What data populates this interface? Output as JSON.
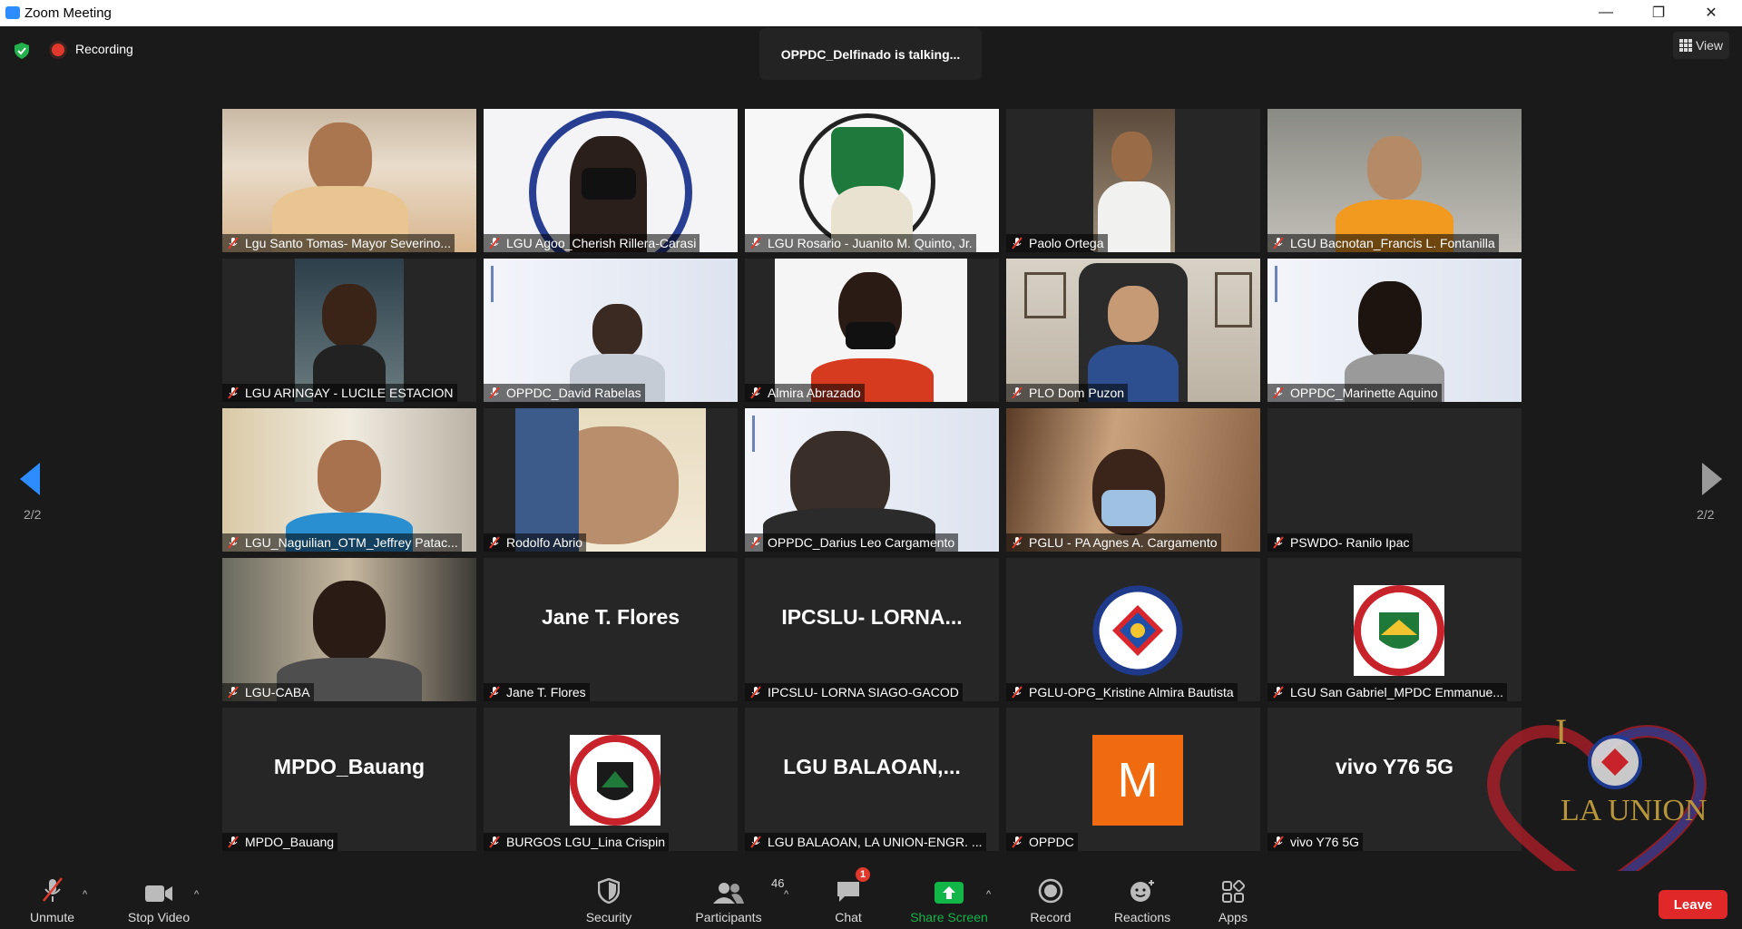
{
  "window": {
    "title": "Zoom Meeting"
  },
  "topbar": {
    "recording_label": "Recording",
    "talking": "OPPDC_Delfinado is talking...",
    "view_label": "View"
  },
  "pagination": {
    "left_page": "2/2",
    "right_page": "2/2"
  },
  "participants": [
    {
      "name": "Lgu Santo Tomas- Mayor Severino..."
    },
    {
      "name": "LGU Agoo_Cherish Rillera-Carasi"
    },
    {
      "name": "LGU Rosario - Juanito M. Quinto, Jr."
    },
    {
      "name": "Paolo Ortega"
    },
    {
      "name": "LGU Bacnotan_Francis L. Fontanilla"
    },
    {
      "name": "LGU ARINGAY - LUCILE ESTACION"
    },
    {
      "name": "OPPDC_David Rabelas"
    },
    {
      "name": "Almira Abrazado"
    },
    {
      "name": "PLO Dom Puzon"
    },
    {
      "name": "OPPDC_Marinette Aquino"
    },
    {
      "name": "LGU_Naguilian_OTM_Jeffrey Patac..."
    },
    {
      "name": "Rodolfo Abrio"
    },
    {
      "name": "OPPDC_Darius Leo Cargamento"
    },
    {
      "name": "PGLU - PA Agnes A. Cargamento"
    },
    {
      "name": "PSWDO- Ranilo Ipac"
    },
    {
      "name": "LGU-CABA"
    },
    {
      "name": "Jane T. Flores",
      "display": "Jane T. Flores"
    },
    {
      "name": "IPCSLU- LORNA SIAGO-GACOD",
      "display": "IPCSLU-  LORNA..."
    },
    {
      "name": "PGLU-OPG_Kristine Almira Bautista"
    },
    {
      "name": "LGU San Gabriel_MPDC Emmanue..."
    },
    {
      "name": "MPDO_Bauang",
      "display": "MPDO_Bauang"
    },
    {
      "name": "BURGOS LGU_Lina Crispin"
    },
    {
      "name": "LGU BALAOAN, LA UNION-ENGR. ...",
      "display": "LGU  BALAOAN,..."
    },
    {
      "name": "OPPDC",
      "avatar_letter": "M"
    },
    {
      "name": "vivo Y76 5G",
      "display": "vivo Y76 5G"
    }
  ],
  "toolbar": {
    "unmute": "Unmute",
    "stop_video": "Stop Video",
    "security": "Security",
    "participants": "Participants",
    "participants_count": "46",
    "chat": "Chat",
    "chat_badge": "1",
    "share_screen": "Share Screen",
    "record": "Record",
    "reactions": "Reactions",
    "apps": "Apps",
    "leave": "Leave"
  },
  "watermark": {
    "text_i": "I",
    "text_place": "LA UNION"
  },
  "colors": {
    "accent_green": "#12b548",
    "leave_red": "#e02828",
    "zoom_blue": "#2d8cff",
    "badge_red": "#e0392b"
  }
}
